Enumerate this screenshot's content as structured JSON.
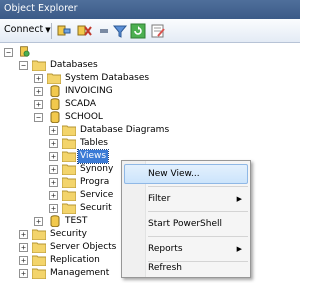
{
  "window": {
    "title": "Object Explorer"
  },
  "toolbar": {
    "connect_label": "Connect",
    "icons": [
      "connect-icon",
      "disconnect-icon",
      "stop-icon",
      "filter-icon",
      "refresh-icon",
      "activity-monitor-icon"
    ]
  },
  "tree": {
    "server": {
      "label": ""
    },
    "databases": {
      "label": "Databases"
    },
    "system_databases": {
      "label": "System Databases"
    },
    "invoicing": {
      "label": "INVOICING"
    },
    "scada": {
      "label": "SCADA"
    },
    "school": {
      "label": "SCHOOL"
    },
    "database_diagrams": {
      "label": "Database Diagrams"
    },
    "tables": {
      "label": "Tables"
    },
    "views": {
      "label": "Views"
    },
    "synonyms": {
      "label": "Synony"
    },
    "programmability": {
      "label": "Progra"
    },
    "service": {
      "label": "Service"
    },
    "security_school": {
      "label": "Securit"
    },
    "test": {
      "label": "TEST"
    },
    "security": {
      "label": "Security"
    },
    "server_objects": {
      "label": "Server Objects"
    },
    "replication": {
      "label": "Replication"
    },
    "management": {
      "label": "Management"
    }
  },
  "context_menu": {
    "new_view": "New View...",
    "filter": "Filter",
    "start_powershell": "Start PowerShell",
    "reports": "Reports",
    "refresh": "Refresh"
  }
}
